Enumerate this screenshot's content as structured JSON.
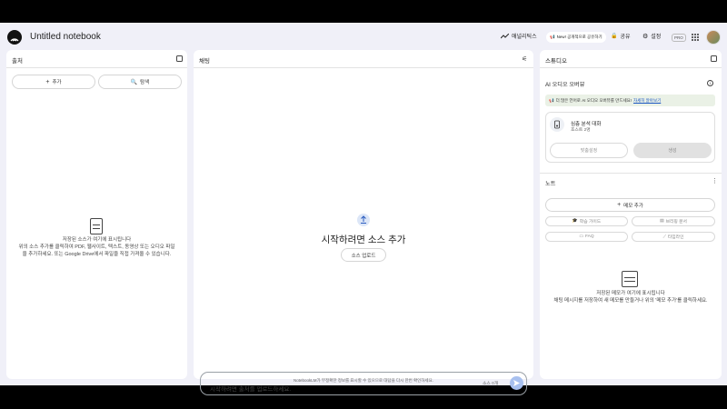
{
  "header": {
    "notebook_title": "Untitled notebook",
    "analytics_label": "애널리틱스",
    "new_pill_label": "New! 공개적으로 공유하기",
    "share_label": "공유",
    "settings_label": "설정",
    "pro_badge": "PRO"
  },
  "sources": {
    "title": "출처",
    "add_label": "추가",
    "search_label": "탐색",
    "empty_title": "저장된 소스가 여기에 표시됩니다",
    "empty_line1": "위의 소스 추가를 클릭하여 PDF, 웹사이트, 텍스트, 동영상 또는 오디오 파일",
    "empty_line2": "을 추가하세요. 또는 Google Drive에서 파일을 직접 가져올 수 있습니다."
  },
  "chat": {
    "title": "채팅",
    "start_title": "시작하려면 소스 추가",
    "upload_label": "소스 업로드",
    "input_placeholder": "시작하려면 출처를 업로드하세요.",
    "source_count": "소스 0개",
    "footer_notice": "NotebookLM가 부정확한 정보를 표시할 수 있으므로 대답을 다시 한번 확인하세요."
  },
  "studio": {
    "title": "스튜디오",
    "audio_title": "AI 오디오 오버뷰",
    "banner_text": "더 많은 언어로 AI 오디오 오버뷰를 만드세요!",
    "banner_link": "자세히 알아보기",
    "card_title": "심층 분석 대화",
    "card_sub": "호스트 2명",
    "customize_label": "맞춤설정",
    "generate_label": "생성",
    "notes_title": "노트",
    "add_note_label": "메모 추가",
    "chips": [
      "학습 가이드",
      "브리핑 문서",
      "FAQ",
      "타임라인"
    ],
    "empty_title": "저장된 메모가 여기에 표시됩니다",
    "empty_desc": "채팅 메시지를 저장하여 새 메모를 만들거나 위의 '메모 추가'를 클릭하세요."
  },
  "colors": {
    "accent_blue": "#1a56c2",
    "send_button": "#a8c0ef",
    "banner_bg": "#eaf1e6"
  }
}
